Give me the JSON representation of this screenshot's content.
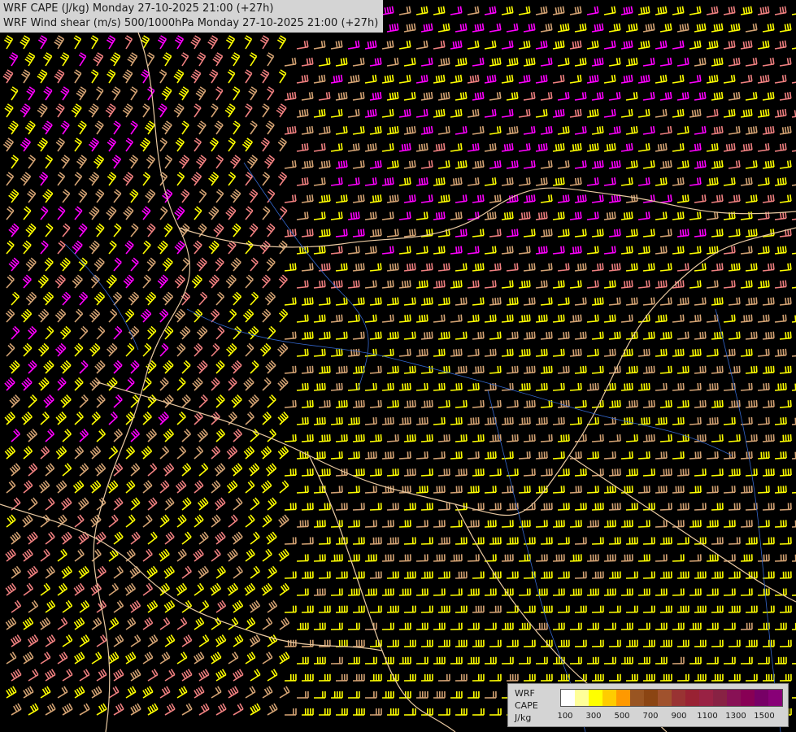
{
  "header": {
    "line1": "WRF CAPE (J/kg) Monday 27-10-2025 21:00 (+27h)",
    "line2": "WRF Wind shear (m/s) 500/1000hPa Monday 27-10-2025 21:00 (+27h)"
  },
  "legend": {
    "line1": "WRF",
    "line2": "CAPE",
    "line3": "J/kg",
    "swatch_colors": [
      "#ffffff",
      "#ffff99",
      "#ffff00",
      "#ffcc00",
      "#ff9900",
      "#995522",
      "#8b4513",
      "#a0522d",
      "#993333",
      "#992233",
      "#992244",
      "#882244",
      "#881155",
      "#880055",
      "#770066",
      "#880077"
    ],
    "ticks": [
      "100",
      "300",
      "500",
      "700",
      "900",
      "1100",
      "1300",
      "1500"
    ]
  },
  "map": {
    "background_color": "#000000",
    "barb_colors": {
      "yellow": "#ffff00",
      "tan": "#d4a373",
      "salmon": "#f08080",
      "magenta": "#ff00ff"
    },
    "border_color": "#e8c8a0",
    "river_color": "#3366cc"
  }
}
